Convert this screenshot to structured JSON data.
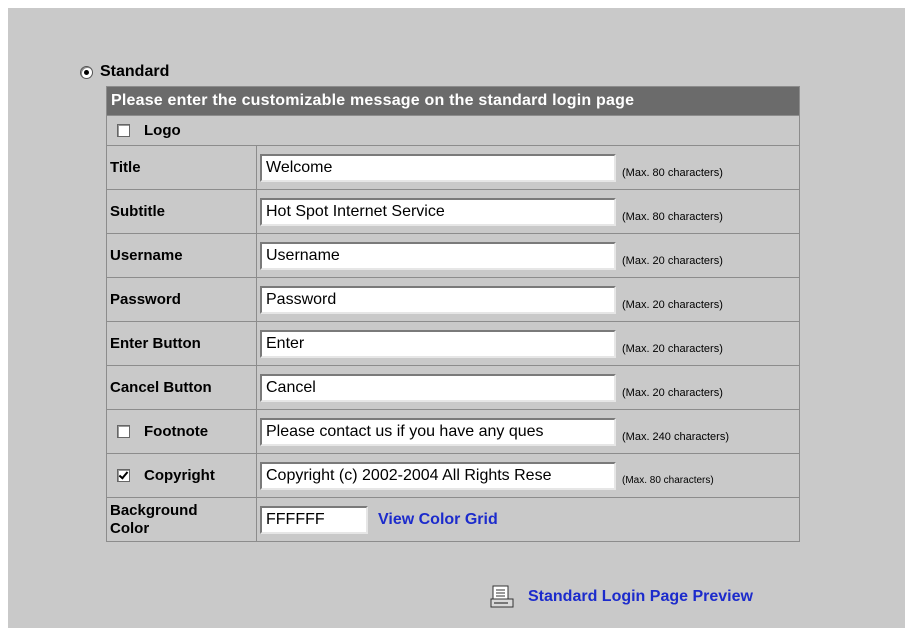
{
  "mode_radio": {
    "label": "Standard",
    "selected": true
  },
  "table": {
    "header": "Please enter the customizable message on the standard login page",
    "logo": {
      "label": "Logo",
      "checked": false
    },
    "rows": [
      {
        "label": "Title",
        "value": "Welcome",
        "hint": "(Max. 80 characters)"
      },
      {
        "label": "Subtitle",
        "value": "Hot Spot Internet Service",
        "hint": "(Max. 80 characters)"
      },
      {
        "label": "Username",
        "value": "Username",
        "hint": "(Max. 20 characters)"
      },
      {
        "label": "Password",
        "value": "Password",
        "hint": "(Max. 20 characters)"
      },
      {
        "label": "Enter Button",
        "value": "Enter",
        "hint": "(Max. 20 characters)"
      },
      {
        "label": "Cancel Button",
        "value": "Cancel",
        "hint": "(Max. 20 characters)"
      }
    ],
    "footnote": {
      "label": "Footnote",
      "checked": false,
      "value": "Please contact us if you have any ques",
      "hint": "(Max. 240 characters)"
    },
    "copyright": {
      "label": "Copyright",
      "checked": true,
      "value": "Copyright (c) 2002-2004 All Rights Rese",
      "hint": "(Max. 80 characters)"
    },
    "background": {
      "label_line1": "Background",
      "label_line2": "Color",
      "value": "FFFFFF",
      "link": "View Color Grid"
    }
  },
  "preview": {
    "link": "Standard Login Page Preview",
    "icon": "document-preview-icon"
  },
  "colors": {
    "panel_bg": "#c9c9c9",
    "header_bg": "#6b6b6b",
    "link": "#1c2bcc"
  }
}
